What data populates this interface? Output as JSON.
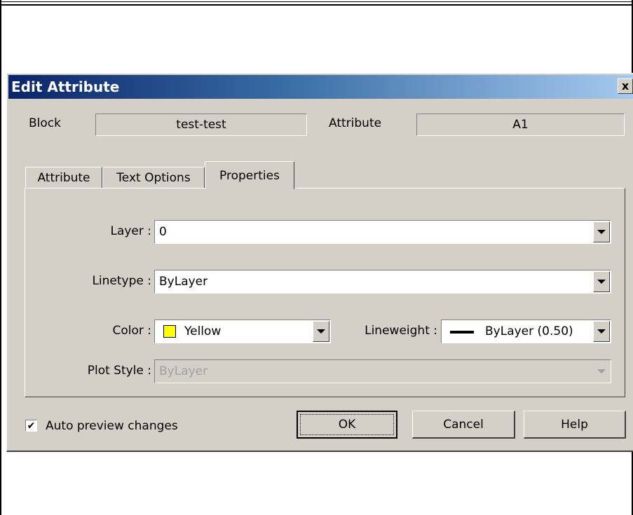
{
  "dialog": {
    "title": "Edit Attribute",
    "close_glyph": "x"
  },
  "header": {
    "block_label": "Block",
    "block_value": "test-test",
    "attribute_label": "Attribute",
    "attribute_value": "A1"
  },
  "tabs": [
    {
      "label": "Attribute",
      "active": false
    },
    {
      "label": "Text Options",
      "active": false
    },
    {
      "label": "Properties",
      "active": true
    }
  ],
  "properties": {
    "layer_label": "Layer :",
    "layer_value": "0",
    "linetype_label": "Linetype :",
    "linetype_value": "ByLayer",
    "color_label": "Color :",
    "color_value": "Yellow",
    "color_swatch": "#ffff00",
    "lineweight_label": "Lineweight :",
    "lineweight_value": "ByLayer (0.50)",
    "plotstyle_label": "Plot Style :",
    "plotstyle_value": "ByLayer"
  },
  "footer": {
    "auto_preview_label": "Auto preview changes",
    "auto_preview_checked": true,
    "ok_label": "OK",
    "cancel_label": "Cancel",
    "help_label": "Help"
  }
}
